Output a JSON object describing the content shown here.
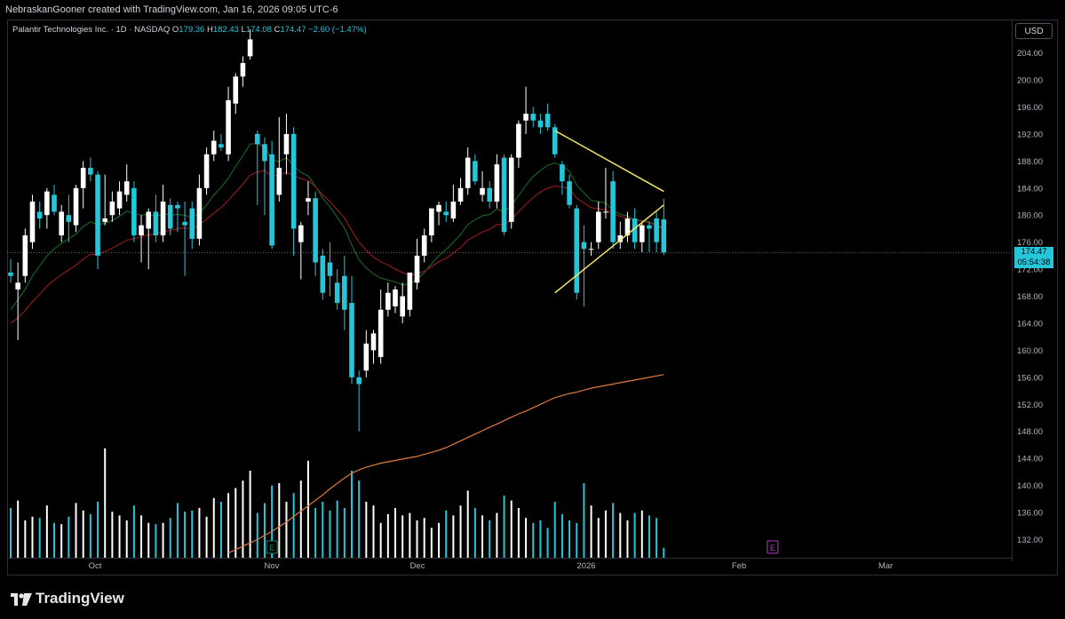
{
  "header": {
    "credit": "NebraskanGooner created with TradingView.com, Jan 16, 2026 09:05 UTC-6"
  },
  "legend": {
    "symbol": "Palantir Technologies Inc. · 1D · NASDAQ",
    "open_label": "O",
    "open": "179.36",
    "high_label": "H",
    "high": "182.43",
    "low_label": "L",
    "low": "174.08",
    "close_label": "C",
    "close": "174.47",
    "change": "−2.60 (−1.47%)"
  },
  "currency": "USD",
  "last_price": {
    "value": "174.47",
    "countdown": "05:54:38"
  },
  "footer": {
    "brand": "TradingView"
  },
  "colors": {
    "up": "#ffffff",
    "down": "#26c6da",
    "ema_fast": "#1b5e20",
    "ema_mid": "#8b1a1a",
    "ma_long": "#e07a3c",
    "trendline": "#f5e663",
    "earnings": "#2e7d5b",
    "earnings_future": "#b23acb"
  },
  "chart_data": {
    "type": "candlestick",
    "title": "Palantir Technologies Inc. · 1D · NASDAQ",
    "yaxis": {
      "ticks": [
        "132.00",
        "136.00",
        "140.00",
        "144.00",
        "148.00",
        "152.00",
        "156.00",
        "160.00",
        "164.00",
        "168.00",
        "172.00",
        "176.00",
        "180.00",
        "184.00",
        "188.00",
        "192.00",
        "196.00",
        "200.00",
        "204.00"
      ],
      "range": [
        130.5,
        208
      ]
    },
    "xaxis": {
      "ticks": [
        "Oct",
        "Nov",
        "Dec",
        "2026",
        "Feb",
        "Mar"
      ]
    },
    "grid": false,
    "candles": [
      {
        "o": 171.5,
        "h": 173.5,
        "l": 170,
        "c": 171
      },
      {
        "o": 169,
        "h": 173,
        "l": 161.5,
        "c": 170
      },
      {
        "o": 171,
        "h": 178,
        "l": 170,
        "c": 177
      },
      {
        "o": 176,
        "h": 183,
        "l": 175,
        "c": 182
      },
      {
        "o": 180.5,
        "h": 182,
        "l": 178,
        "c": 179.5
      },
      {
        "o": 180,
        "h": 184,
        "l": 178,
        "c": 183.5
      },
      {
        "o": 183,
        "h": 184.5,
        "l": 180,
        "c": 180.5
      },
      {
        "o": 177,
        "h": 181.5,
        "l": 176,
        "c": 180.5
      },
      {
        "o": 180,
        "h": 183,
        "l": 176,
        "c": 179
      },
      {
        "o": 178.5,
        "h": 184.5,
        "l": 177.5,
        "c": 184
      },
      {
        "o": 184,
        "h": 188,
        "l": 181,
        "c": 187
      },
      {
        "o": 187,
        "h": 188.5,
        "l": 185,
        "c": 186
      },
      {
        "o": 186,
        "h": 186.5,
        "l": 172,
        "c": 174
      },
      {
        "o": 179,
        "h": 186,
        "l": 178.5,
        "c": 179.5
      },
      {
        "o": 180,
        "h": 183.5,
        "l": 179,
        "c": 182
      },
      {
        "o": 181,
        "h": 185,
        "l": 180,
        "c": 183.5
      },
      {
        "o": 183,
        "h": 187.5,
        "l": 182,
        "c": 185
      },
      {
        "o": 184,
        "h": 185,
        "l": 176,
        "c": 177
      },
      {
        "o": 177,
        "h": 180,
        "l": 173,
        "c": 178.5
      },
      {
        "o": 178,
        "h": 181,
        "l": 172,
        "c": 180.5
      },
      {
        "o": 180.5,
        "h": 183,
        "l": 176,
        "c": 177
      },
      {
        "o": 177,
        "h": 184.5,
        "l": 176,
        "c": 182
      },
      {
        "o": 181.5,
        "h": 182.5,
        "l": 177,
        "c": 178
      },
      {
        "o": 181.5,
        "h": 182,
        "l": 177.5,
        "c": 181
      },
      {
        "o": 179,
        "h": 182,
        "l": 171,
        "c": 178.5
      },
      {
        "o": 181,
        "h": 182,
        "l": 175,
        "c": 176.5
      },
      {
        "o": 176.5,
        "h": 186,
        "l": 175.5,
        "c": 184
      },
      {
        "o": 184,
        "h": 190,
        "l": 183,
        "c": 189
      },
      {
        "o": 189,
        "h": 192.5,
        "l": 188,
        "c": 191
      },
      {
        "o": 190.5,
        "h": 192,
        "l": 189.5,
        "c": 190
      },
      {
        "o": 189,
        "h": 199,
        "l": 188,
        "c": 197
      },
      {
        "o": 196.5,
        "h": 201,
        "l": 195,
        "c": 200.5
      },
      {
        "o": 200.5,
        "h": 203.5,
        "l": 199,
        "c": 202.5
      },
      {
        "o": 203.5,
        "h": 207.5,
        "l": 203,
        "c": 206
      },
      {
        "o": 192,
        "h": 192.5,
        "l": 181.5,
        "c": 190.5
      },
      {
        "o": 190.5,
        "h": 191.5,
        "l": 180,
        "c": 188
      },
      {
        "o": 189,
        "h": 191,
        "l": 175,
        "c": 175.5
      },
      {
        "o": 183,
        "h": 194.5,
        "l": 182,
        "c": 187
      },
      {
        "o": 189,
        "h": 195,
        "l": 186,
        "c": 192
      },
      {
        "o": 192,
        "h": 193,
        "l": 174,
        "c": 178
      },
      {
        "o": 176,
        "h": 179,
        "l": 170.5,
        "c": 178.5
      },
      {
        "o": 182,
        "h": 185,
        "l": 180,
        "c": 182.5
      },
      {
        "o": 182.5,
        "h": 183.5,
        "l": 171,
        "c": 173
      },
      {
        "o": 174,
        "h": 175,
        "l": 167.5,
        "c": 168.5
      },
      {
        "o": 173,
        "h": 176,
        "l": 168,
        "c": 171
      },
      {
        "o": 170,
        "h": 172,
        "l": 166,
        "c": 167
      },
      {
        "o": 171,
        "h": 174,
        "l": 163,
        "c": 166
      },
      {
        "o": 167,
        "h": 171,
        "l": 155,
        "c": 156
      },
      {
        "o": 156,
        "h": 157,
        "l": 148,
        "c": 155
      },
      {
        "o": 157,
        "h": 163,
        "l": 156,
        "c": 161
      },
      {
        "o": 160,
        "h": 163,
        "l": 158,
        "c": 162.5
      },
      {
        "o": 159,
        "h": 169,
        "l": 158,
        "c": 166
      },
      {
        "o": 166,
        "h": 170,
        "l": 165,
        "c": 168.5
      },
      {
        "o": 166.5,
        "h": 169.5,
        "l": 165.5,
        "c": 169
      },
      {
        "o": 165,
        "h": 170,
        "l": 164,
        "c": 168
      },
      {
        "o": 166,
        "h": 171,
        "l": 165,
        "c": 171.5
      },
      {
        "o": 170,
        "h": 176.5,
        "l": 169,
        "c": 174
      },
      {
        "o": 174,
        "h": 178,
        "l": 173,
        "c": 177
      },
      {
        "o": 177,
        "h": 181,
        "l": 176,
        "c": 181
      },
      {
        "o": 180.5,
        "h": 182,
        "l": 178.5,
        "c": 181.5
      },
      {
        "o": 180.5,
        "h": 182,
        "l": 179,
        "c": 180
      },
      {
        "o": 179.5,
        "h": 184.5,
        "l": 179,
        "c": 182
      },
      {
        "o": 182,
        "h": 185.5,
        "l": 181.5,
        "c": 184
      },
      {
        "o": 184,
        "h": 190,
        "l": 183,
        "c": 188.5
      },
      {
        "o": 188,
        "h": 189,
        "l": 184.5,
        "c": 185
      },
      {
        "o": 183,
        "h": 186.5,
        "l": 182,
        "c": 184
      },
      {
        "o": 184,
        "h": 185,
        "l": 181,
        "c": 182
      },
      {
        "o": 182,
        "h": 189,
        "l": 181,
        "c": 187.5
      },
      {
        "o": 188.5,
        "h": 189,
        "l": 177,
        "c": 177.5
      },
      {
        "o": 179,
        "h": 189,
        "l": 178,
        "c": 188.5
      },
      {
        "o": 188.5,
        "h": 194,
        "l": 187,
        "c": 193.5
      },
      {
        "o": 194,
        "h": 199,
        "l": 192,
        "c": 195
      },
      {
        "o": 195,
        "h": 196,
        "l": 193,
        "c": 194
      },
      {
        "o": 194,
        "h": 195,
        "l": 192,
        "c": 193
      },
      {
        "o": 195,
        "h": 196.5,
        "l": 192.5,
        "c": 193
      },
      {
        "o": 193,
        "h": 193.5,
        "l": 188.5,
        "c": 189
      },
      {
        "o": 187.5,
        "h": 188,
        "l": 183,
        "c": 185
      },
      {
        "o": 185,
        "h": 186,
        "l": 181,
        "c": 181.5
      },
      {
        "o": 181,
        "h": 181.5,
        "l": 167.5,
        "c": 168.5
      },
      {
        "o": 176,
        "h": 178.5,
        "l": 166.5,
        "c": 175
      },
      {
        "o": 175,
        "h": 176,
        "l": 174,
        "c": 175
      },
      {
        "o": 176,
        "h": 182,
        "l": 175,
        "c": 180.5
      },
      {
        "o": 180.5,
        "h": 187,
        "l": 179.5,
        "c": 180.5
      },
      {
        "o": 185,
        "h": 186.5,
        "l": 175,
        "c": 176
      },
      {
        "o": 176,
        "h": 179,
        "l": 175,
        "c": 177
      },
      {
        "o": 177,
        "h": 180.5,
        "l": 176,
        "c": 179.5
      },
      {
        "o": 179.5,
        "h": 181,
        "l": 175,
        "c": 176
      },
      {
        "o": 176,
        "h": 179,
        "l": 174.5,
        "c": 178.5
      },
      {
        "o": 178.5,
        "h": 179,
        "l": 174.5,
        "c": 178
      },
      {
        "o": 179.5,
        "h": 180.5,
        "l": 174.5,
        "c": 176
      },
      {
        "o": 179.36,
        "h": 182.43,
        "l": 174.08,
        "c": 174.47
      }
    ],
    "series": [
      {
        "kind": "line",
        "values_start": 0,
        "values": [
          166,
          167.5,
          169,
          171,
          172.5,
          174,
          175,
          175.8,
          176.5,
          177.2,
          178.3,
          179,
          178.6,
          178.8,
          179.2,
          179.8,
          180.6,
          180.2,
          180,
          180.1,
          179.8,
          180.2,
          180,
          180.1,
          180,
          179.6,
          180.3,
          181.5,
          183,
          184.1,
          185.5,
          187.2,
          188.8,
          190.5,
          190.6,
          190.1,
          188.2,
          187.9,
          188.5,
          187.3,
          186.3,
          185.8,
          184.3,
          182.5,
          181.2,
          179.7,
          178.1,
          175.6,
          173.4,
          172.2,
          171.3,
          170.7,
          170.4,
          170.1,
          169.7,
          169.8,
          170.5,
          171.5,
          172.8,
          174,
          174.9,
          176,
          177.1,
          178.6,
          179.3,
          179.9,
          180.1,
          180.9,
          180.5,
          181.4,
          182.9,
          184.4,
          185.7,
          186.6,
          187.4,
          187.7,
          187.3,
          186.5,
          184.4,
          183.3,
          182.2,
          182,
          181.8,
          180.7,
          180.1,
          179.9,
          179.3,
          179.2,
          179,
          178.5,
          177.9
        ]
      },
      {
        "kind": "line",
        "values_start": 0,
        "values": [
          164,
          164.8,
          165.9,
          167.2,
          168.3,
          169.5,
          170.4,
          171.2,
          171.9,
          172.6,
          173.5,
          174.2,
          174.2,
          174.6,
          175.1,
          175.7,
          176.3,
          176.5,
          176.8,
          177.1,
          177.2,
          177.6,
          177.7,
          178,
          178.1,
          178,
          178.6,
          179.4,
          180.3,
          181.1,
          182.2,
          183.4,
          184.6,
          185.9,
          186.4,
          186.6,
          185.8,
          185.9,
          186.4,
          185.8,
          185.4,
          185.1,
          184.2,
          183,
          182,
          180.8,
          179.6,
          177.7,
          176,
          174.8,
          173.8,
          173.1,
          172.6,
          172,
          171.5,
          171.1,
          171.3,
          171.7,
          172.4,
          173.1,
          173.6,
          174.4,
          175.2,
          176.3,
          176.9,
          177.5,
          177.9,
          178.6,
          178.6,
          179.4,
          180.5,
          181.6,
          182.6,
          183.4,
          184,
          184.3,
          184.2,
          183.8,
          182.5,
          181.8,
          181.1,
          180.9,
          180.8,
          180.2,
          179.8,
          179.6,
          179.2,
          179.1,
          178.9,
          178.5,
          178.1
        ]
      },
      {
        "kind": "line",
        "values_start": 30,
        "values": [
          130,
          130.5,
          131,
          131.5,
          132,
          132.6,
          133.2,
          133.9,
          134.6,
          135.4,
          136.2,
          137,
          137.8,
          138.6,
          139.5,
          140.3,
          141.1,
          141.8,
          142.3,
          142.7,
          143,
          143.3,
          143.5,
          143.7,
          143.9,
          144.1,
          144.3,
          144.6,
          144.9,
          145.2,
          145.6,
          146.1,
          146.6,
          147.1,
          147.6,
          148.1,
          148.6,
          149.1,
          149.6,
          150.1,
          150.6,
          151,
          151.5,
          152,
          152.5,
          153,
          153.3,
          153.6,
          153.8,
          154.1,
          154.4,
          154.6,
          154.8,
          155,
          155.2,
          155.4,
          155.6,
          155.8,
          156,
          156.2,
          156.4
        ]
      }
    ],
    "volume_scale_max": 100,
    "volume": [
      40,
      46,
      30,
      33,
      32,
      42,
      28,
      27,
      33,
      44,
      38,
      35,
      45,
      88,
      37,
      34,
      30,
      42,
      34,
      28,
      27,
      28,
      32,
      44,
      37,
      38,
      40,
      33,
      48,
      45,
      52,
      56,
      62,
      70,
      36,
      44,
      58,
      60,
      45,
      52,
      62,
      78,
      40,
      45,
      38,
      46,
      40,
      70,
      62,
      45,
      42,
      28,
      35,
      40,
      34,
      36,
      30,
      32,
      24,
      28,
      38,
      34,
      42,
      54,
      40,
      34,
      30,
      36,
      50,
      46,
      40,
      32,
      28,
      30,
      24,
      45,
      35,
      30,
      28,
      60,
      42,
      32,
      38,
      44,
      36,
      30,
      36,
      38,
      34,
      32,
      8
    ],
    "trendlines": [
      {
        "from": [
          75,
          192.5
        ],
        "to": [
          90,
          183.5
        ]
      },
      {
        "from": [
          75,
          168.5
        ],
        "to": [
          90,
          181.5
        ]
      }
    ],
    "earnings_markers": [
      {
        "candle": 36,
        "label": "E"
      },
      {
        "candle": 105,
        "label": "E"
      }
    ]
  }
}
